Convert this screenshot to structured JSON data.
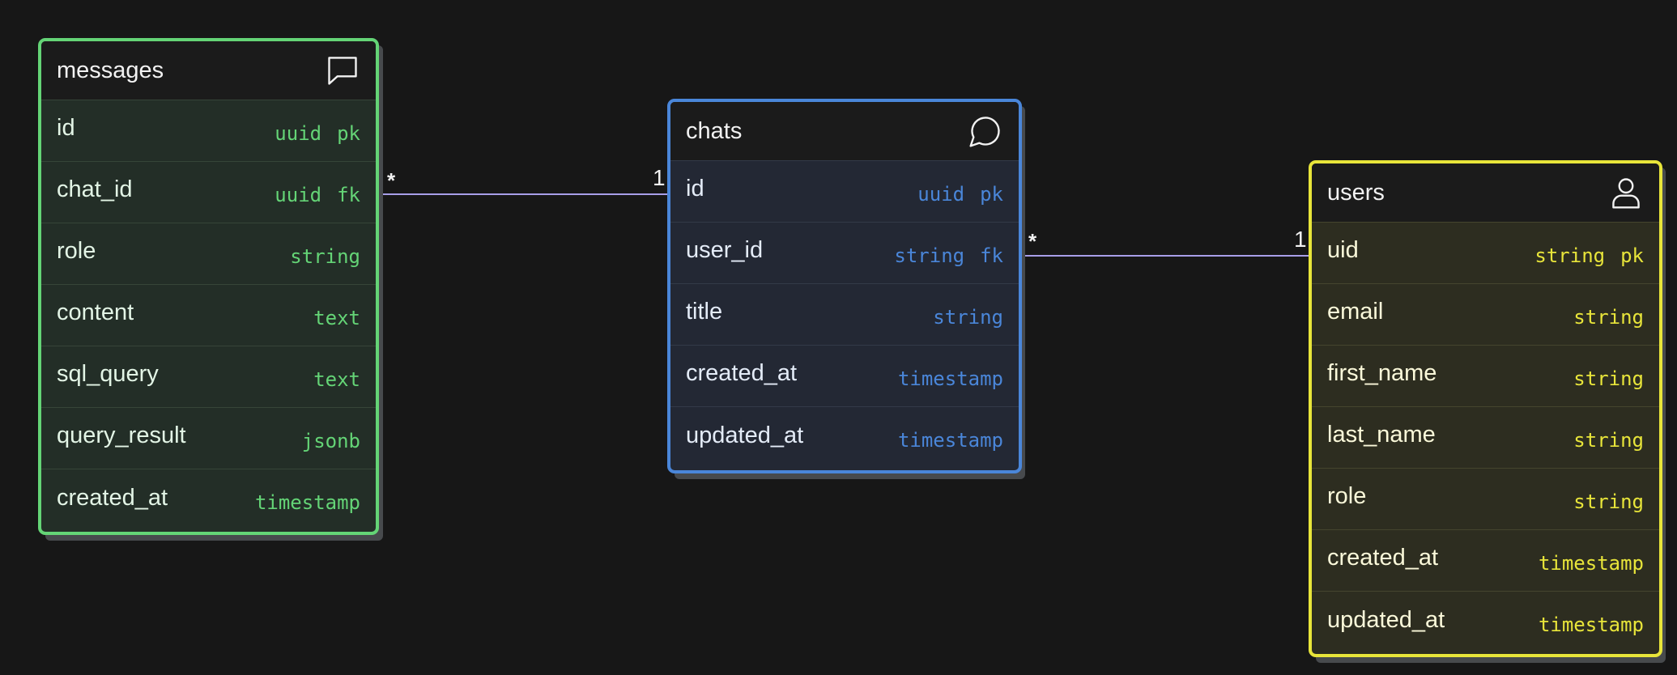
{
  "colors": {
    "background": "#171717",
    "messages_accent": "#64d476",
    "chats_accent": "#4a86d9",
    "users_accent": "#e8e53a",
    "edge": "#a89ee8"
  },
  "tables": {
    "messages": {
      "title": "messages",
      "icon": "message-square-icon",
      "fields": [
        {
          "name": "id",
          "type": "uuid",
          "key": "pk"
        },
        {
          "name": "chat_id",
          "type": "uuid",
          "key": "fk"
        },
        {
          "name": "role",
          "type": "string",
          "key": ""
        },
        {
          "name": "content",
          "type": "text",
          "key": ""
        },
        {
          "name": "sql_query",
          "type": "text",
          "key": ""
        },
        {
          "name": "query_result",
          "type": "jsonb",
          "key": ""
        },
        {
          "name": "created_at",
          "type": "timestamp",
          "key": ""
        }
      ]
    },
    "chats": {
      "title": "chats",
      "icon": "message-circle-icon",
      "fields": [
        {
          "name": "id",
          "type": "uuid",
          "key": "pk"
        },
        {
          "name": "user_id",
          "type": "string",
          "key": "fk"
        },
        {
          "name": "title",
          "type": "string",
          "key": ""
        },
        {
          "name": "created_at",
          "type": "timestamp",
          "key": ""
        },
        {
          "name": "updated_at",
          "type": "timestamp",
          "key": ""
        }
      ]
    },
    "users": {
      "title": "users",
      "icon": "user-icon",
      "fields": [
        {
          "name": "uid",
          "type": "string",
          "key": "pk"
        },
        {
          "name": "email",
          "type": "string",
          "key": ""
        },
        {
          "name": "first_name",
          "type": "string",
          "key": ""
        },
        {
          "name": "last_name",
          "type": "string",
          "key": ""
        },
        {
          "name": "role",
          "type": "string",
          "key": ""
        },
        {
          "name": "created_at",
          "type": "timestamp",
          "key": ""
        },
        {
          "name": "updated_at",
          "type": "timestamp",
          "key": ""
        }
      ]
    }
  },
  "relations": [
    {
      "from": "messages.chat_id",
      "to": "chats.id",
      "from_cardinality": "*",
      "to_cardinality": "1"
    },
    {
      "from": "chats.user_id",
      "to": "users.uid",
      "from_cardinality": "*",
      "to_cardinality": "1"
    }
  ]
}
